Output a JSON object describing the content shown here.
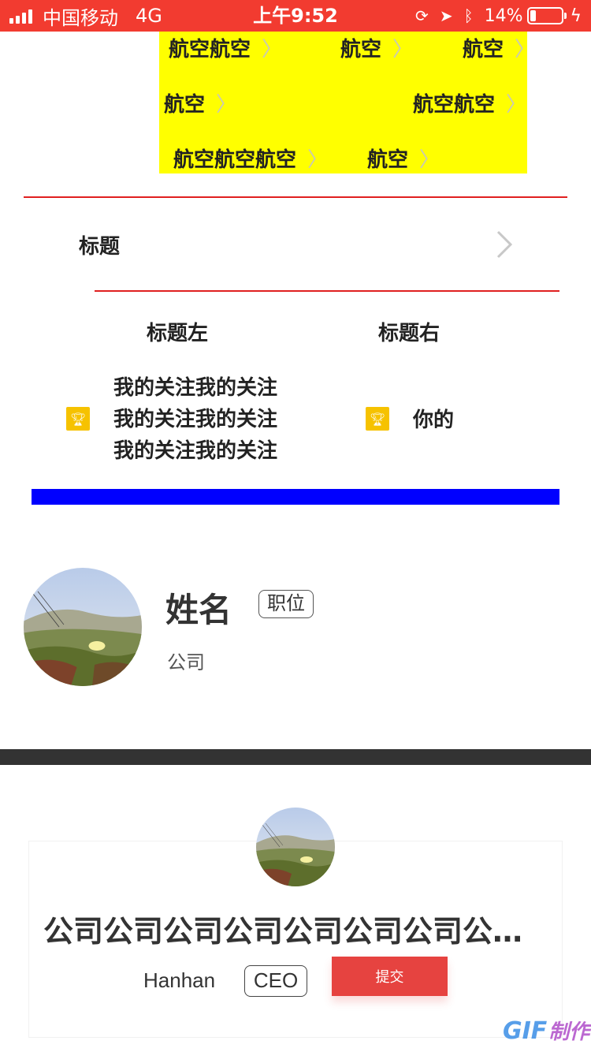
{
  "status_bar": {
    "carrier": "中国移动",
    "network": "4G",
    "time": "上午9:52",
    "battery": "14%",
    "battery_level": 0.14,
    "icons": [
      "signal-icon",
      "orientation-lock-icon",
      "location-icon",
      "bluetooth-icon",
      "battery-icon",
      "charging-icon"
    ]
  },
  "tag_box": {
    "background": "#ffff00",
    "tags": [
      "航空航空",
      "航空",
      "航空",
      "航空",
      "航空航空",
      "航空航空航空",
      "航空"
    ]
  },
  "title_row": {
    "title": "标题"
  },
  "columns": {
    "left_title": "标题左",
    "right_title": "标题右",
    "left_lines": [
      "我的关注我的关注",
      "我的关注我的关注",
      "我的关注我的关注"
    ],
    "right_text": "你的",
    "icon": "trophy-icon",
    "icon_color": "#f6c200"
  },
  "colors": {
    "status_bar": "#f23b30",
    "divider_red": "#e02020",
    "blue_bar": "#0000ff",
    "dark_bar": "#333333",
    "submit_button": "#e64340"
  },
  "profile": {
    "name": "姓名",
    "position": "职位",
    "company": "公司"
  },
  "card": {
    "company": "公司公司公司公司公司公司公司公司公司公司公司",
    "name": "Hanhan",
    "position": "CEO",
    "submit_label": "提交"
  },
  "watermark": {
    "text": "GIF",
    "suffix": "制作"
  }
}
